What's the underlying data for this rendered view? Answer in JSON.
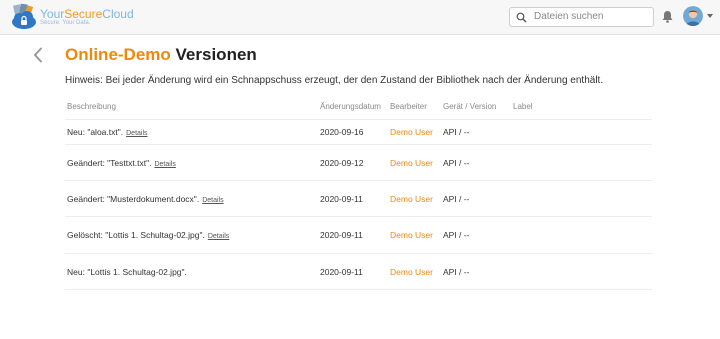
{
  "header": {
    "brand_part1": "Your",
    "brand_part2": "Secure",
    "brand_part3": "Cloud",
    "tagline": "Secure. Your Data.",
    "search_placeholder": "Dateien suchen"
  },
  "page": {
    "title_highlight": "Online-Demo",
    "title_rest": "Versionen",
    "hint": "Hinweis: Bei jeder Änderung wird ein Schnappschuss erzeugt, der den Zustand der Bibliothek nach der Änderung enthält."
  },
  "table": {
    "columns": {
      "description": "Beschreibung",
      "date": "Änderungsdatum",
      "editor": "Bearbeiter",
      "device": "Gerät / Version",
      "label": "Label"
    },
    "rows": [
      {
        "description": "Neu: \"aloa.txt\".",
        "details": "Details",
        "date": "2020-09-16",
        "editor": "Demo User",
        "device": "API / --"
      },
      {
        "description": "Geändert: \"Testtxt.txt\".",
        "details": "Details",
        "date": "2020-09-12",
        "editor": "Demo User",
        "device": "API / --"
      },
      {
        "description": "Geändert: \"Musterdokument.docx\".",
        "details": "Details",
        "date": "2020-09-11",
        "editor": "Demo User",
        "device": "API / --"
      },
      {
        "description": "Gelöscht: \"Lottis 1. Schultag-02.jpg\".",
        "details": "Details",
        "date": "2020-09-11",
        "editor": "Demo User",
        "device": "API / --"
      },
      {
        "description": "Neu: \"Lottis 1. Schultag-02.jpg\".",
        "details": "",
        "date": "2020-09-11",
        "editor": "Demo User",
        "device": "API / --"
      }
    ]
  }
}
